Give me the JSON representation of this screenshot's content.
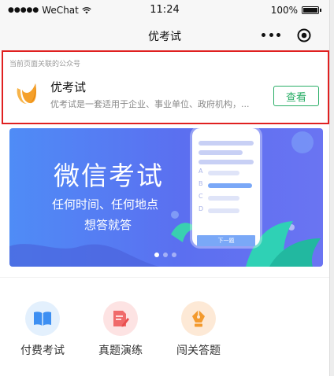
{
  "statusbar": {
    "carrier": "WeChat",
    "time": "11:24",
    "battery": "100%"
  },
  "navbar": {
    "title": "优考试"
  },
  "official_account": {
    "caption": "当前页面关联的公众号",
    "name": "优考试",
    "description": "优考试是一套适用于企业、事业单位、政府机构，...",
    "view_button": "查看"
  },
  "banner": {
    "title": "微信考试",
    "subtitle_line1": "任何时间、任何地点",
    "subtitle_line2": "想答就答",
    "mock": {
      "options": [
        "A",
        "B",
        "C",
        "D"
      ],
      "next_button": "下一题"
    },
    "slides": 3,
    "active_slide": 1
  },
  "menu": [
    {
      "label": "付费考试",
      "icon": "book-icon"
    },
    {
      "label": "真题演练",
      "icon": "edit-document-icon"
    },
    {
      "label": "闯关答题",
      "icon": "pen-nib-icon"
    }
  ],
  "colors": {
    "accent_green": "#2aae67",
    "highlight_red": "#e02020",
    "banner_blue": "#4f8cf6"
  }
}
